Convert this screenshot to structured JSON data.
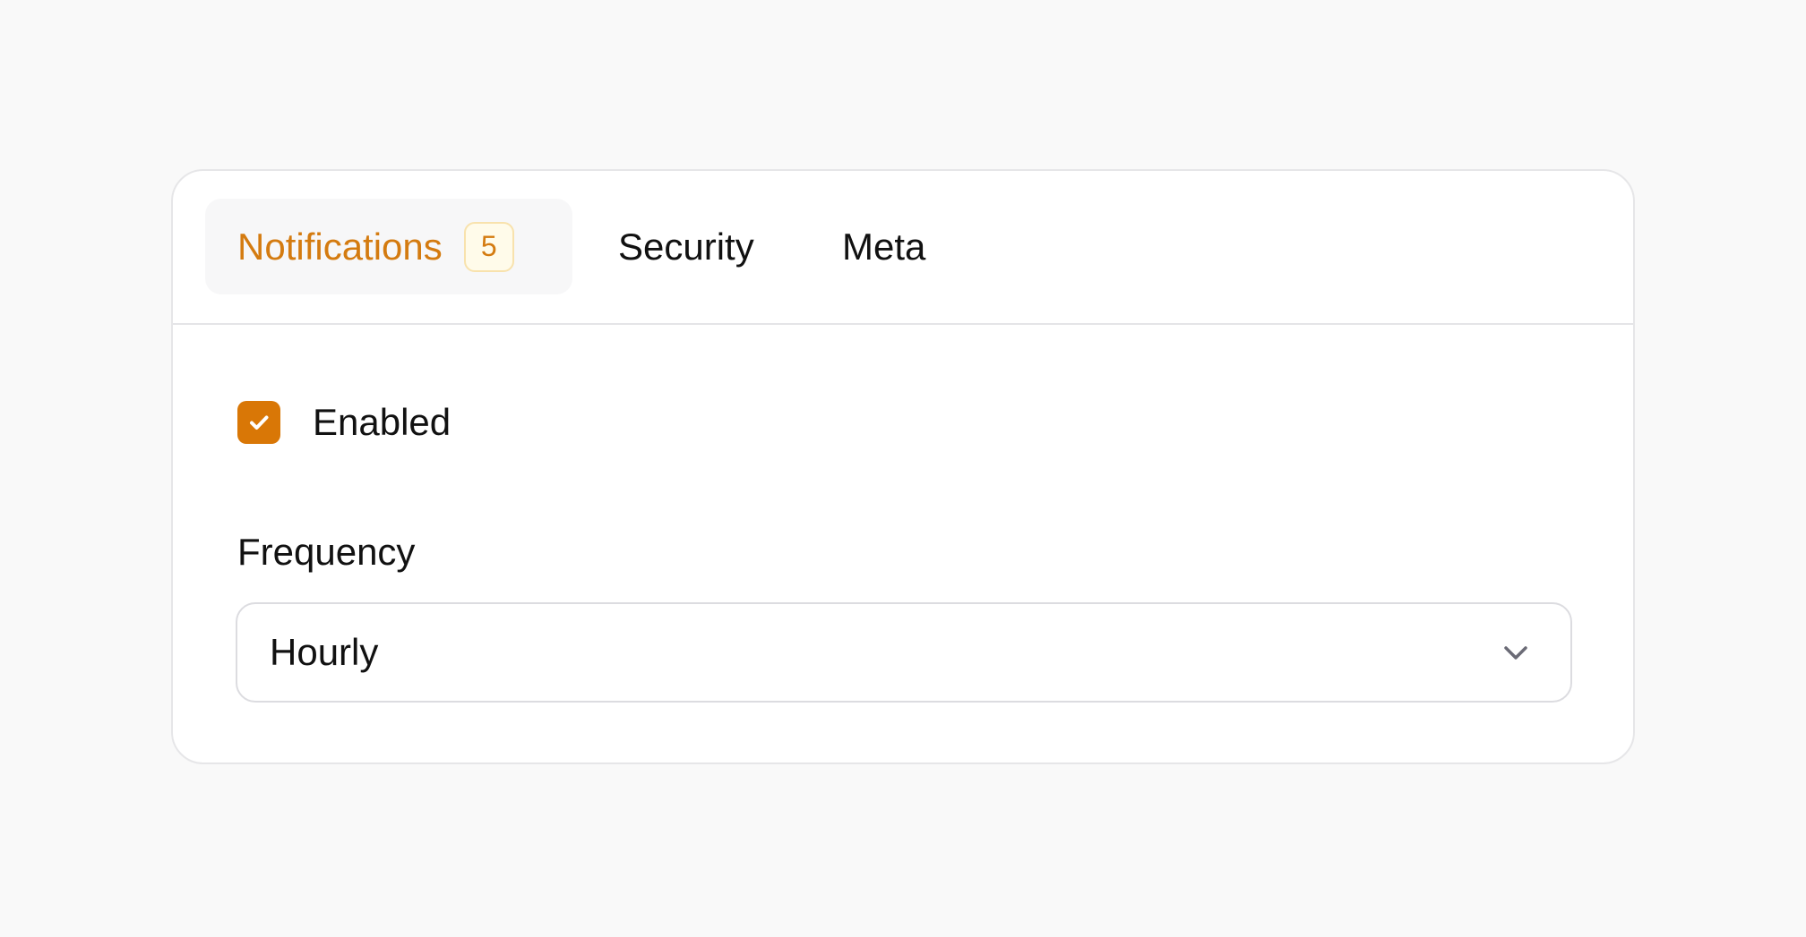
{
  "tabs": [
    {
      "label": "Notifications",
      "badge": "5",
      "active": true
    },
    {
      "label": "Security",
      "active": false
    },
    {
      "label": "Meta",
      "active": false
    }
  ],
  "notifications": {
    "enabled": {
      "label": "Enabled",
      "checked": true
    },
    "frequency": {
      "label": "Frequency",
      "value": "Hourly"
    }
  },
  "icons": {
    "checkbox": "check-icon",
    "select": "chevron-down-icon"
  },
  "colors": {
    "accent": "#d97706",
    "active_tab_text": "#d47b10",
    "badge_background": "#fffbea",
    "badge_border": "#f8e2ad",
    "page_background": "#f9f9f9"
  }
}
